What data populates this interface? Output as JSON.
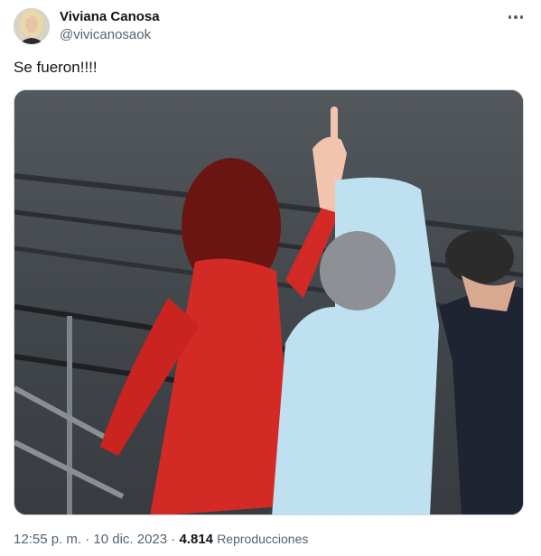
{
  "author": {
    "name": "Viviana Canosa",
    "handle": "@vivicanosaok"
  },
  "tweet": {
    "text": "Se fueron!!!!"
  },
  "meta": {
    "time": "12:55 p. m.",
    "separator": "·",
    "date": "10 dic. 2023",
    "views_count": "4.814",
    "views_label": "Reproducciones"
  },
  "icons": {
    "more": "more-horizontal-icon"
  },
  "colors": {
    "text_primary": "#0f1419",
    "text_secondary": "#536471",
    "border": "#cfd9de"
  }
}
